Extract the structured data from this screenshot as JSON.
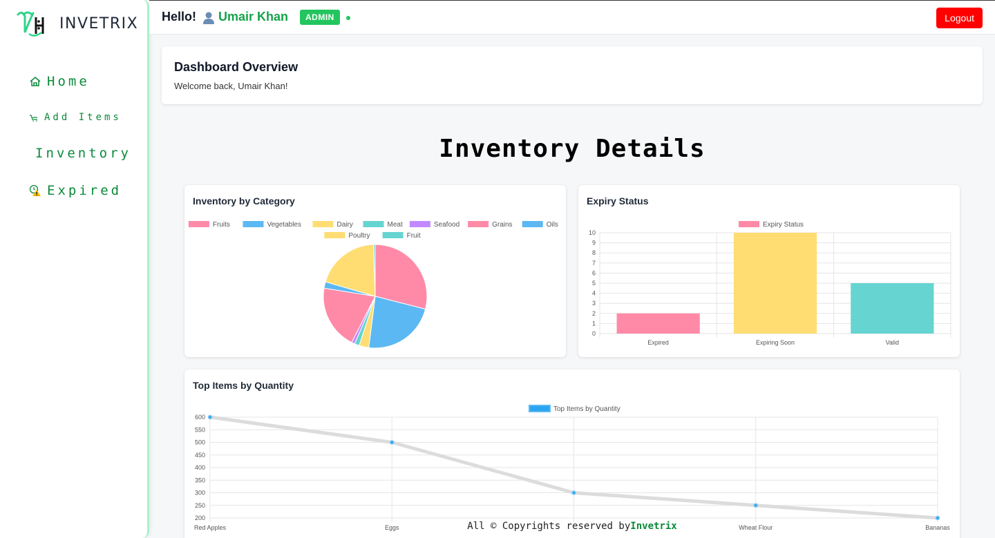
{
  "brand": {
    "name": "INVETRIX"
  },
  "sidebar": {
    "items": [
      {
        "label": "Home",
        "icon": "home-icon"
      },
      {
        "label": "Add Items",
        "icon": "cart-icon"
      },
      {
        "label": "Inventory",
        "icon": ""
      },
      {
        "label": "Expired",
        "icon": "expired-warning-icon"
      }
    ]
  },
  "header": {
    "greeting": "Hello!",
    "user_name": "Umair Khan",
    "role_badge": "ADMIN",
    "logout_label": "Logout"
  },
  "overview": {
    "title": "Dashboard Overview",
    "welcome": "Welcome back, Umair Khan!"
  },
  "page_title": "Inventory Details",
  "colors": {
    "accent": "#16a34a",
    "pink": "#ff8aa8",
    "blue": "#5cb8f3",
    "yellow": "#ffdd73",
    "teal": "#66d4d0",
    "purple": "#c18aff",
    "logout": "#ff0000"
  },
  "chart_data": [
    {
      "type": "pie",
      "title": "Inventory by Category",
      "labels": [
        "Fruits",
        "Vegetables",
        "Dairy",
        "Meat",
        "Seafood",
        "Grains",
        "Oils",
        "Poultry",
        "Fruit"
      ],
      "values": [
        29,
        23,
        3,
        1.5,
        1,
        20,
        2,
        20,
        0.5
      ],
      "colors": [
        "#ff8aa8",
        "#5cb8f3",
        "#ffdd73",
        "#66d4d0",
        "#c18aff",
        "#ff8aa8",
        "#5cb8f3",
        "#ffdd73",
        "#66d4d0"
      ],
      "legend": "top"
    },
    {
      "type": "bar",
      "title": "Expiry Status",
      "legend_label": "Expiry Status",
      "categories": [
        "Expired",
        "Expiring Soon",
        "Valid"
      ],
      "values": [
        2,
        10,
        5
      ],
      "colors": [
        "#ff8aa8",
        "#ffdd73",
        "#66d4d0"
      ],
      "ylim": [
        0,
        10
      ],
      "yticks": [
        0,
        1,
        2,
        3,
        4,
        5,
        6,
        7,
        8,
        9,
        10
      ],
      "grid": true
    },
    {
      "type": "line",
      "title": "Top Items by Quantity",
      "legend_label": "Top Items by Quantity",
      "categories": [
        "Red Apples",
        "Eggs",
        "",
        "Wheat Flour",
        "Bananas"
      ],
      "values": [
        600,
        500,
        300,
        250,
        200
      ],
      "ylim": [
        200,
        600
      ],
      "yticks": [
        200,
        250,
        300,
        350,
        400,
        450,
        500,
        550,
        600
      ],
      "grid": true
    }
  ],
  "footer": {
    "text": "All © Copyrights reserved by",
    "brand": "Invetrix"
  }
}
